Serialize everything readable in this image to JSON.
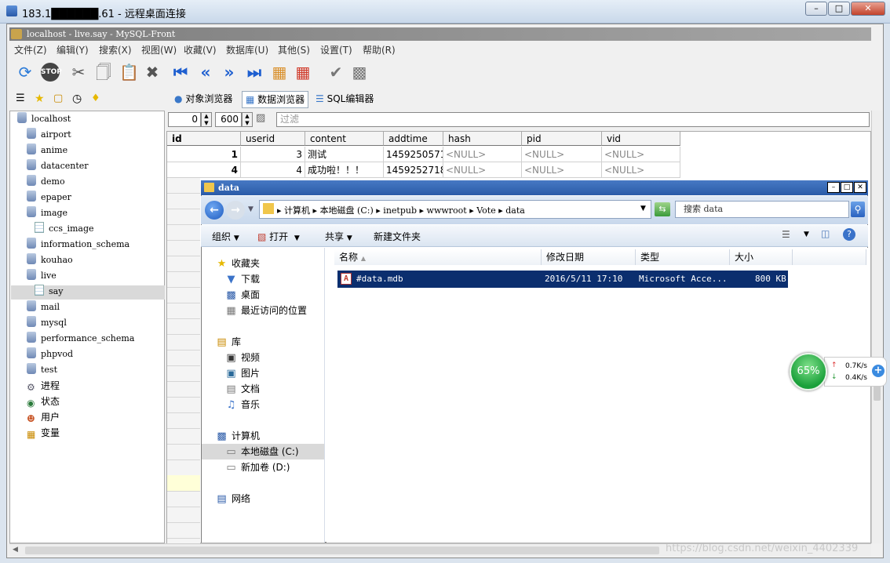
{
  "rdp": {
    "title": "183.1██████.61 - 远程桌面连接"
  },
  "mysqlfront": {
    "title": "localhost - live.say - MySQL-Front",
    "menu": [
      "文件(Z)",
      "编辑(Y)",
      "搜索(X)",
      "视图(W)",
      "收藏(V)",
      "数据库(U)",
      "其他(S)",
      "设置(T)",
      "帮助(R)"
    ],
    "toolbar_icons": [
      "refresh-icon",
      "stop-icon",
      "cut-icon",
      "copy-icon",
      "paste-icon",
      "delete-icon",
      "first-icon",
      "prev-icon",
      "next-icon",
      "last-icon",
      "insert-record-icon",
      "delete-record-icon",
      "post-icon",
      "cancel-icon"
    ],
    "tabs": {
      "object_browser": "对象浏览器",
      "data_browser": "数据浏览器",
      "sql_editor": "SQL编辑器"
    },
    "filter": {
      "offset": "0",
      "limit": "600",
      "placeholder": "过滤"
    },
    "tree": {
      "root": "localhost",
      "databases": [
        "airport",
        "anime",
        "datacenter",
        "demo",
        "epaper",
        "image"
      ],
      "image_tables": [
        "ccs_image"
      ],
      "databases2": [
        "information_schema",
        "kouhao",
        "live"
      ],
      "live_tables": [
        "say"
      ],
      "databases3": [
        "mail",
        "mysql",
        "performance_schema",
        "phpvod",
        "test"
      ],
      "extra": [
        "进程",
        "状态",
        "用户",
        "变量"
      ]
    },
    "grid": {
      "columns": [
        "id",
        "userid",
        "content",
        "addtime",
        "hash",
        "pid",
        "vid"
      ],
      "rows": [
        [
          "1",
          "3",
          "测试",
          "1459250571",
          "<NULL>",
          "<NULL>",
          "<NULL>"
        ],
        [
          "4",
          "4",
          "成功啦！！！",
          "1459252718",
          "<NULL>",
          "<NULL>",
          "<NULL>"
        ]
      ]
    }
  },
  "explorer": {
    "title": "data",
    "breadcrumb": [
      "计算机",
      "本地磁盘 (C:)",
      "inetpub",
      "wwwroot",
      "Vote",
      "data"
    ],
    "search_placeholder": "搜索 data",
    "commands": {
      "organize": "组织",
      "open": "打开",
      "share": "共享",
      "new_folder": "新建文件夹"
    },
    "nav": {
      "favorites": "收藏夹",
      "downloads": "下载",
      "desktop": "桌面",
      "recent": "最近访问的位置",
      "libraries": "库",
      "videos": "视频",
      "pictures": "图片",
      "documents": "文档",
      "music": "音乐",
      "computer": "计算机",
      "drive_c": "本地磁盘 (C:)",
      "drive_d": "新加卷 (D:)",
      "network": "网络"
    },
    "headers": {
      "name": "名称",
      "modified": "修改日期",
      "type": "类型",
      "size": "大小"
    },
    "files": [
      {
        "name": "#data.mdb",
        "modified": "2016/5/11 17:10",
        "type": "Microsoft Acce...",
        "size": "800 KB"
      }
    ]
  },
  "net_widget": {
    "percent": "65%",
    "up": "0.7K/s",
    "down": "0.4K/s"
  },
  "watermark": "https://blog.csdn.net/weixin_4402339"
}
